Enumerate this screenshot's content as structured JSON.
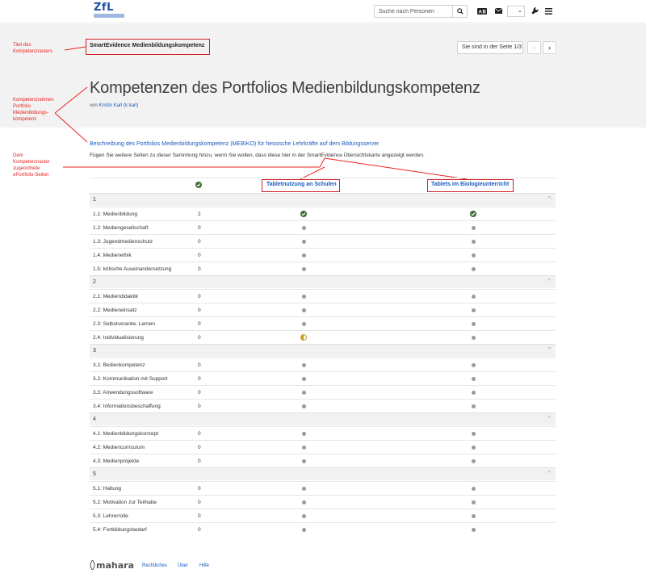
{
  "header": {
    "logo_text": "ZfL",
    "search_placeholder": "Suche nach Personen",
    "icons": [
      "search-icon",
      "language-icon",
      "mail-icon",
      "chevron-down-icon",
      "wrench-icon",
      "menu-icon"
    ]
  },
  "collection": {
    "title": "SmartEvidence Medienbildungskompetenz",
    "page_select": "Sie sind in der Seite 1/3",
    "title_heading": "Kompetenzen des Portfolios Medienbildungskompetenz",
    "by_prefix": "von",
    "author": "Kristin Karl (k.karl)",
    "description_link": "Beschreibung des Portfolios Medienbildungskompetenz (MEBIKO) für hessische Lehrkräfte auf dem Bildungsserver",
    "description_text": "Fügen Sie weitere Seiten zu dieser Sammlung hinzu, wenn Sie wollen, dass diese hier in der SmartEvidence Übersichtskarte angezeigt werden."
  },
  "annotations": {
    "a1": "Titel des Kompetenzrasters",
    "a2": "Kompetenzrahmen Portfolio Medienbildungs-kompetenz",
    "a3": "Dem Kompetenzraster zugeordnete ePortfolio-Seiten"
  },
  "matrix": {
    "columns": [
      "Tabletnutzung an Schulen",
      "Tablets im Biologieunterricht"
    ],
    "sections": [
      {
        "num": "1",
        "rows": [
          {
            "label": "1.1: Medienbildung",
            "count": "2",
            "c1": "check",
            "c2": "check"
          },
          {
            "label": "1.2: Mediengesellschaft",
            "count": "0",
            "c1": "dot",
            "c2": "dot"
          },
          {
            "label": "1.3: Jugendmedienschutz",
            "count": "0",
            "c1": "dot",
            "c2": "dot"
          },
          {
            "label": "1.4: Medienethik",
            "count": "0",
            "c1": "dot",
            "c2": "dot"
          },
          {
            "label": "1.5: kritische Auseinandersetzung",
            "count": "0",
            "c1": "dot",
            "c2": "dot"
          }
        ]
      },
      {
        "num": "2",
        "rows": [
          {
            "label": "2.1: Mediendidaktik",
            "count": "0",
            "c1": "dot",
            "c2": "dot"
          },
          {
            "label": "2.2: Medieneinsatz",
            "count": "0",
            "c1": "dot",
            "c2": "dot"
          },
          {
            "label": "2.3: Selbstverantw. Lernen",
            "count": "0",
            "c1": "dot",
            "c2": "dot"
          },
          {
            "label": "2.4: Individualisierung",
            "count": "0",
            "c1": "half",
            "c2": "dot"
          }
        ]
      },
      {
        "num": "3",
        "rows": [
          {
            "label": "3.1: Bedienkompetenz",
            "count": "0",
            "c1": "dot",
            "c2": "dot"
          },
          {
            "label": "3.2: Kommunikation mit Support",
            "count": "0",
            "c1": "dot",
            "c2": "dot"
          },
          {
            "label": "3.3: Anwendungssoftware",
            "count": "0",
            "c1": "dot",
            "c2": "dot"
          },
          {
            "label": "3.4: Informationsbeschaffung",
            "count": "0",
            "c1": "dot",
            "c2": "dot"
          }
        ]
      },
      {
        "num": "4",
        "rows": [
          {
            "label": "4.1: Medienbildungskonzept",
            "count": "0",
            "c1": "dot",
            "c2": "dot"
          },
          {
            "label": "4.2: Mediencurriculum",
            "count": "0",
            "c1": "dot",
            "c2": "dot"
          },
          {
            "label": "4.3: Medienprojekte",
            "count": "0",
            "c1": "dot",
            "c2": "dot"
          }
        ]
      },
      {
        "num": "5",
        "rows": [
          {
            "label": "5.1: Haltung",
            "count": "0",
            "c1": "dot",
            "c2": "dot"
          },
          {
            "label": "5.2: Motivation zur Teilhabe",
            "count": "0",
            "c1": "dot",
            "c2": "dot"
          },
          {
            "label": "5.3: Lehrerrolle",
            "count": "0",
            "c1": "dot",
            "c2": "dot"
          },
          {
            "label": "5.4: Fortbildungsbedarf",
            "count": "0",
            "c1": "dot",
            "c2": "dot"
          }
        ]
      }
    ]
  },
  "footer": {
    "brand": "mahara",
    "links": [
      "Rechtliches",
      "Über",
      "Hilfe"
    ]
  },
  "colors": {
    "annotation": "#e8231e",
    "link": "#1a5bbf",
    "check": "#3e6b2f",
    "partial": "#c59a1e"
  }
}
